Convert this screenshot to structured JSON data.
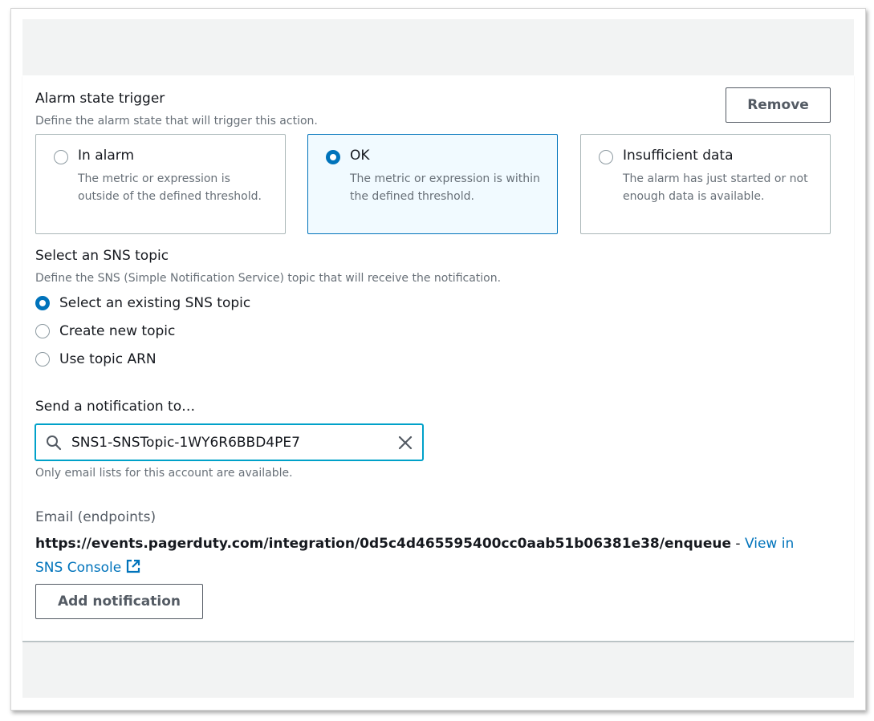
{
  "alarm_state": {
    "title": "Alarm state trigger",
    "description": "Define the alarm state that will trigger this action.",
    "remove_label": "Remove",
    "options": [
      {
        "title": "In alarm",
        "description": "The metric or expression is outside of the defined threshold.",
        "selected": false
      },
      {
        "title": "OK",
        "description": "The metric or expression is within the defined threshold.",
        "selected": true
      },
      {
        "title": "Insufficient data",
        "description": "The alarm has just started or not enough data is available.",
        "selected": false
      }
    ]
  },
  "sns_topic": {
    "title": "Select an SNS topic",
    "description": "Define the SNS (Simple Notification Service) topic that will receive the notification.",
    "options": [
      {
        "label": "Select an existing SNS topic",
        "selected": true
      },
      {
        "label": "Create new topic",
        "selected": false
      },
      {
        "label": "Use topic ARN",
        "selected": false
      }
    ]
  },
  "notification": {
    "title": "Send a notification to…",
    "value": "SNS1-SNSTopic-1WY6R6BBD4PE7",
    "hint": "Only email lists for this account are available.",
    "search_icon": "search-icon",
    "clear_icon": "close-icon"
  },
  "endpoints": {
    "label": "Email (endpoints)",
    "url": "https://events.pagerduty.com/integration/0d5c4d465595400cc0aab51b06381e38/enqueue",
    "separator": " - ",
    "link_label": "View in SNS Console",
    "link_icon": "external-link-icon"
  },
  "add_notification_label": "Add notification",
  "colors": {
    "accent": "#0073bb",
    "focus": "#00a1c9",
    "selected_tile_bg": "#f1faff",
    "band": "#f2f3f3"
  }
}
